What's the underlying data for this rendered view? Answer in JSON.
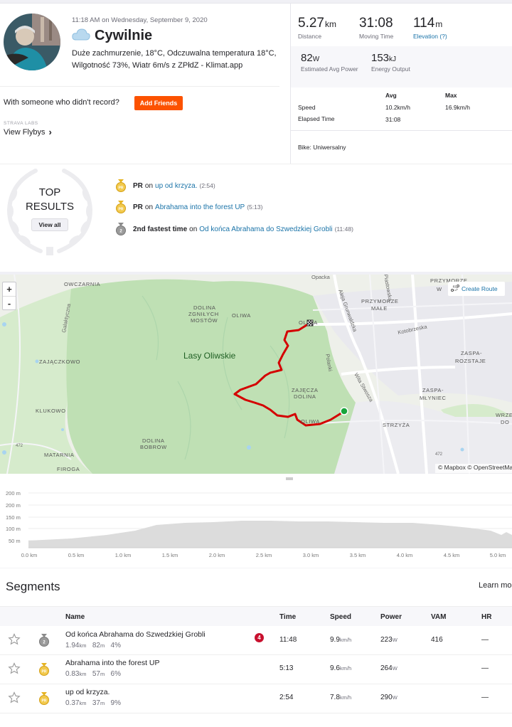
{
  "activity": {
    "datetime": "11:18 AM on Wednesday, September 9, 2020",
    "title": "Cywilnie",
    "weather_icon": "cloud-icon",
    "description": "Duże zachmurzenie, 18°C, Odczuwalna temperatura 18°C, Wilgotność 73%, Wiatr 6m/s z ZPłdZ - Klimat.app"
  },
  "friends": {
    "question": "With someone who didn't record?",
    "button": "Add Friends"
  },
  "flybys": {
    "lab_label": "STRAVA LABS",
    "link": "View Flybys",
    "chevron": "›"
  },
  "stats": {
    "distance": {
      "value": "5.27",
      "unit": "km",
      "label": "Distance"
    },
    "moving_time": {
      "value": "31:08",
      "label": "Moving Time"
    },
    "elevation": {
      "value": "114",
      "unit": "m",
      "label": "Elevation (?)"
    },
    "power": {
      "value": "82",
      "unit": "W",
      "label": "Estimated Avg Power"
    },
    "energy": {
      "value": "153",
      "unit": "kJ",
      "label": "Energy Output"
    }
  },
  "summary_table": {
    "headers": [
      "Avg",
      "Max"
    ],
    "rows": [
      {
        "label": "Speed",
        "avg": "10.2km/h",
        "max": "16.9km/h"
      },
      {
        "label": "Elapsed Time",
        "avg": "31:08",
        "max": ""
      }
    ]
  },
  "bike": "Bike: Uniwersalny",
  "top_results": {
    "title_line1": "TOP",
    "title_line2": "RESULTS",
    "view_all": "View all",
    "achievements": [
      {
        "label": "PR",
        "on": "on",
        "segment": "up od krzyza.",
        "time": "(2:54)",
        "medal": "pr-medal-icon"
      },
      {
        "label": "PR",
        "on": "on",
        "segment": "Abrahama into the forest UP",
        "time": "(5:13)",
        "medal": "pr-medal-icon"
      },
      {
        "label": "2nd fastest time",
        "on": "on",
        "segment": "Od końca Abrahama do Szwedzkiej Grobli",
        "time": "(11:48)",
        "medal": "silver-medal-icon"
      }
    ]
  },
  "map": {
    "zoom_in": "+",
    "zoom_out": "-",
    "create_route": "Create Route",
    "attribution": "© Mapbox © OpenStreetMap",
    "park_label": "Lasy Oliwskie",
    "places": [
      "OWCZARNIA",
      "DOLINA ZGNIŁYCH MOSTÓW",
      "OLIWA",
      "ZAJĄCZKOWO",
      "KLUKOWO",
      "MATARNIA",
      "FIROGA",
      "DOLINA BOBROW",
      "ZAJĘCZA DOLINA",
      "PRZYMORZE MAŁE",
      "PRZYMORZE W",
      "ZASPA-ROZSTAJE",
      "ZASPA-MŁYNIEC",
      "STRZYŻA",
      "WRZE DO",
      "OLIWA",
      "Opacka",
      "Kotobrzeska",
      "Aleja Grunwaldzka",
      "Wita Stwosza",
      "Polanki",
      "Galaktyczna",
      "Piastowska",
      "472"
    ]
  },
  "elevation_chart": {
    "y_ticks": [
      "200 m",
      "200 m",
      "150 m",
      "100 m",
      "50 m"
    ],
    "x_ticks": [
      "0.0 km",
      "0.5 km",
      "1.0 km",
      "1.5 km",
      "2.0 km",
      "2.5 km",
      "3.0 km",
      "3.5 km",
      "4.0 km",
      "4.5 km",
      "5.0 km"
    ]
  },
  "segments": {
    "title": "Segments",
    "learn_more": "Learn mo",
    "headers": {
      "name": "Name",
      "time": "Time",
      "speed": "Speed",
      "power": "Power",
      "vam": "VAM",
      "hr": "HR"
    },
    "rows": [
      {
        "name": "Od końca Abrahama do Szwedzkiej Grobli",
        "dist": "1.94",
        "dist_unit": "km",
        "elev": "82",
        "elev_unit": "m",
        "grade": "4%",
        "badge": "4",
        "time": "11:48",
        "speed": "9.9",
        "speed_unit": "km/h",
        "power": "223",
        "power_unit": "W",
        "vam": "416",
        "hr": "—",
        "medal": "silver-medal-icon"
      },
      {
        "name": "Abrahama into the forest UP",
        "dist": "0.83",
        "dist_unit": "km",
        "elev": "57",
        "elev_unit": "m",
        "grade": "6%",
        "badge": "",
        "time": "5:13",
        "speed": "9.6",
        "speed_unit": "km/h",
        "power": "264",
        "power_unit": "W",
        "vam": "",
        "hr": "—",
        "medal": "pr-medal-icon"
      },
      {
        "name": "up od krzyza.",
        "dist": "0.37",
        "dist_unit": "km",
        "elev": "37",
        "elev_unit": "m",
        "grade": "9%",
        "badge": "",
        "time": "2:54",
        "speed": "7.8",
        "speed_unit": "km/h",
        "power": "290",
        "power_unit": "W",
        "vam": "",
        "hr": "—",
        "medal": "pr-medal-icon"
      }
    ]
  },
  "colors": {
    "accent": "#fc5200",
    "link": "#1a73a8",
    "route": "#d40000",
    "gold": "#e6b422",
    "silver": "#8a8a8a"
  }
}
